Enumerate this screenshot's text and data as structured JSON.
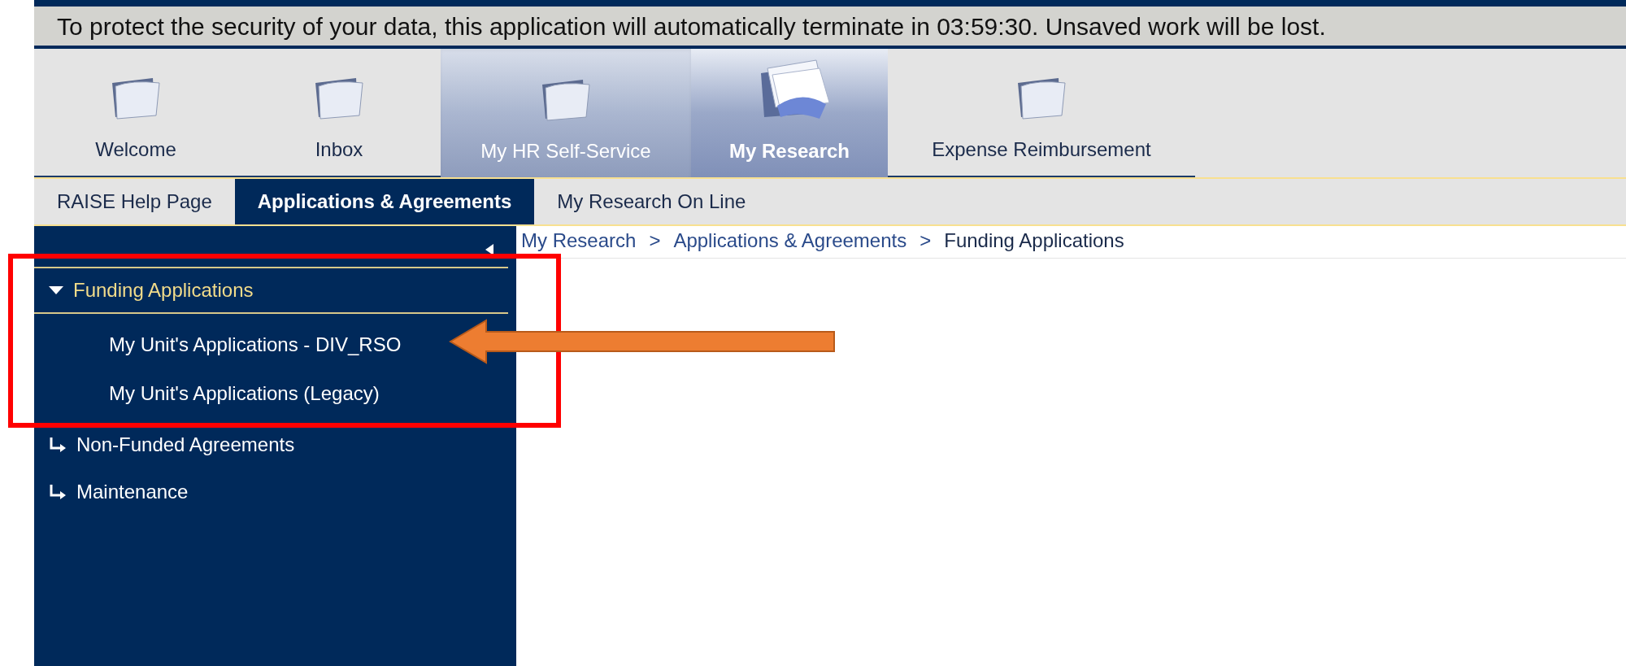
{
  "banner": "To protect the security of your data, this application will automatically terminate in 03:59:30. Unsaved work will be lost.",
  "main_tabs": [
    {
      "label": "Welcome",
      "selected": false,
      "hover": false
    },
    {
      "label": "Inbox",
      "selected": false,
      "hover": false
    },
    {
      "label": "My HR Self-Service",
      "selected": false,
      "hover": true
    },
    {
      "label": "My Research",
      "selected": true,
      "hover": false
    },
    {
      "label": "Expense Reimbursement",
      "selected": false,
      "hover": false
    }
  ],
  "sub_tabs": [
    {
      "label": "RAISE Help Page",
      "selected": false
    },
    {
      "label": "Applications & Agreements",
      "selected": true
    },
    {
      "label": "My Research On Line",
      "selected": false
    }
  ],
  "breadcrumb": [
    "My Research",
    "Applications & Agreements",
    "Funding Applications"
  ],
  "breadcrumb_separator": ">",
  "sidebar": [
    {
      "label": "Funding Applications",
      "expanded": true,
      "children": [
        {
          "label": "My Unit's Applications - DIV_RSO"
        },
        {
          "label": "My Unit's Applications (Legacy)"
        }
      ]
    },
    {
      "label": "Non-Funded Agreements",
      "expanded": false
    },
    {
      "label": "Maintenance",
      "expanded": false
    }
  ]
}
